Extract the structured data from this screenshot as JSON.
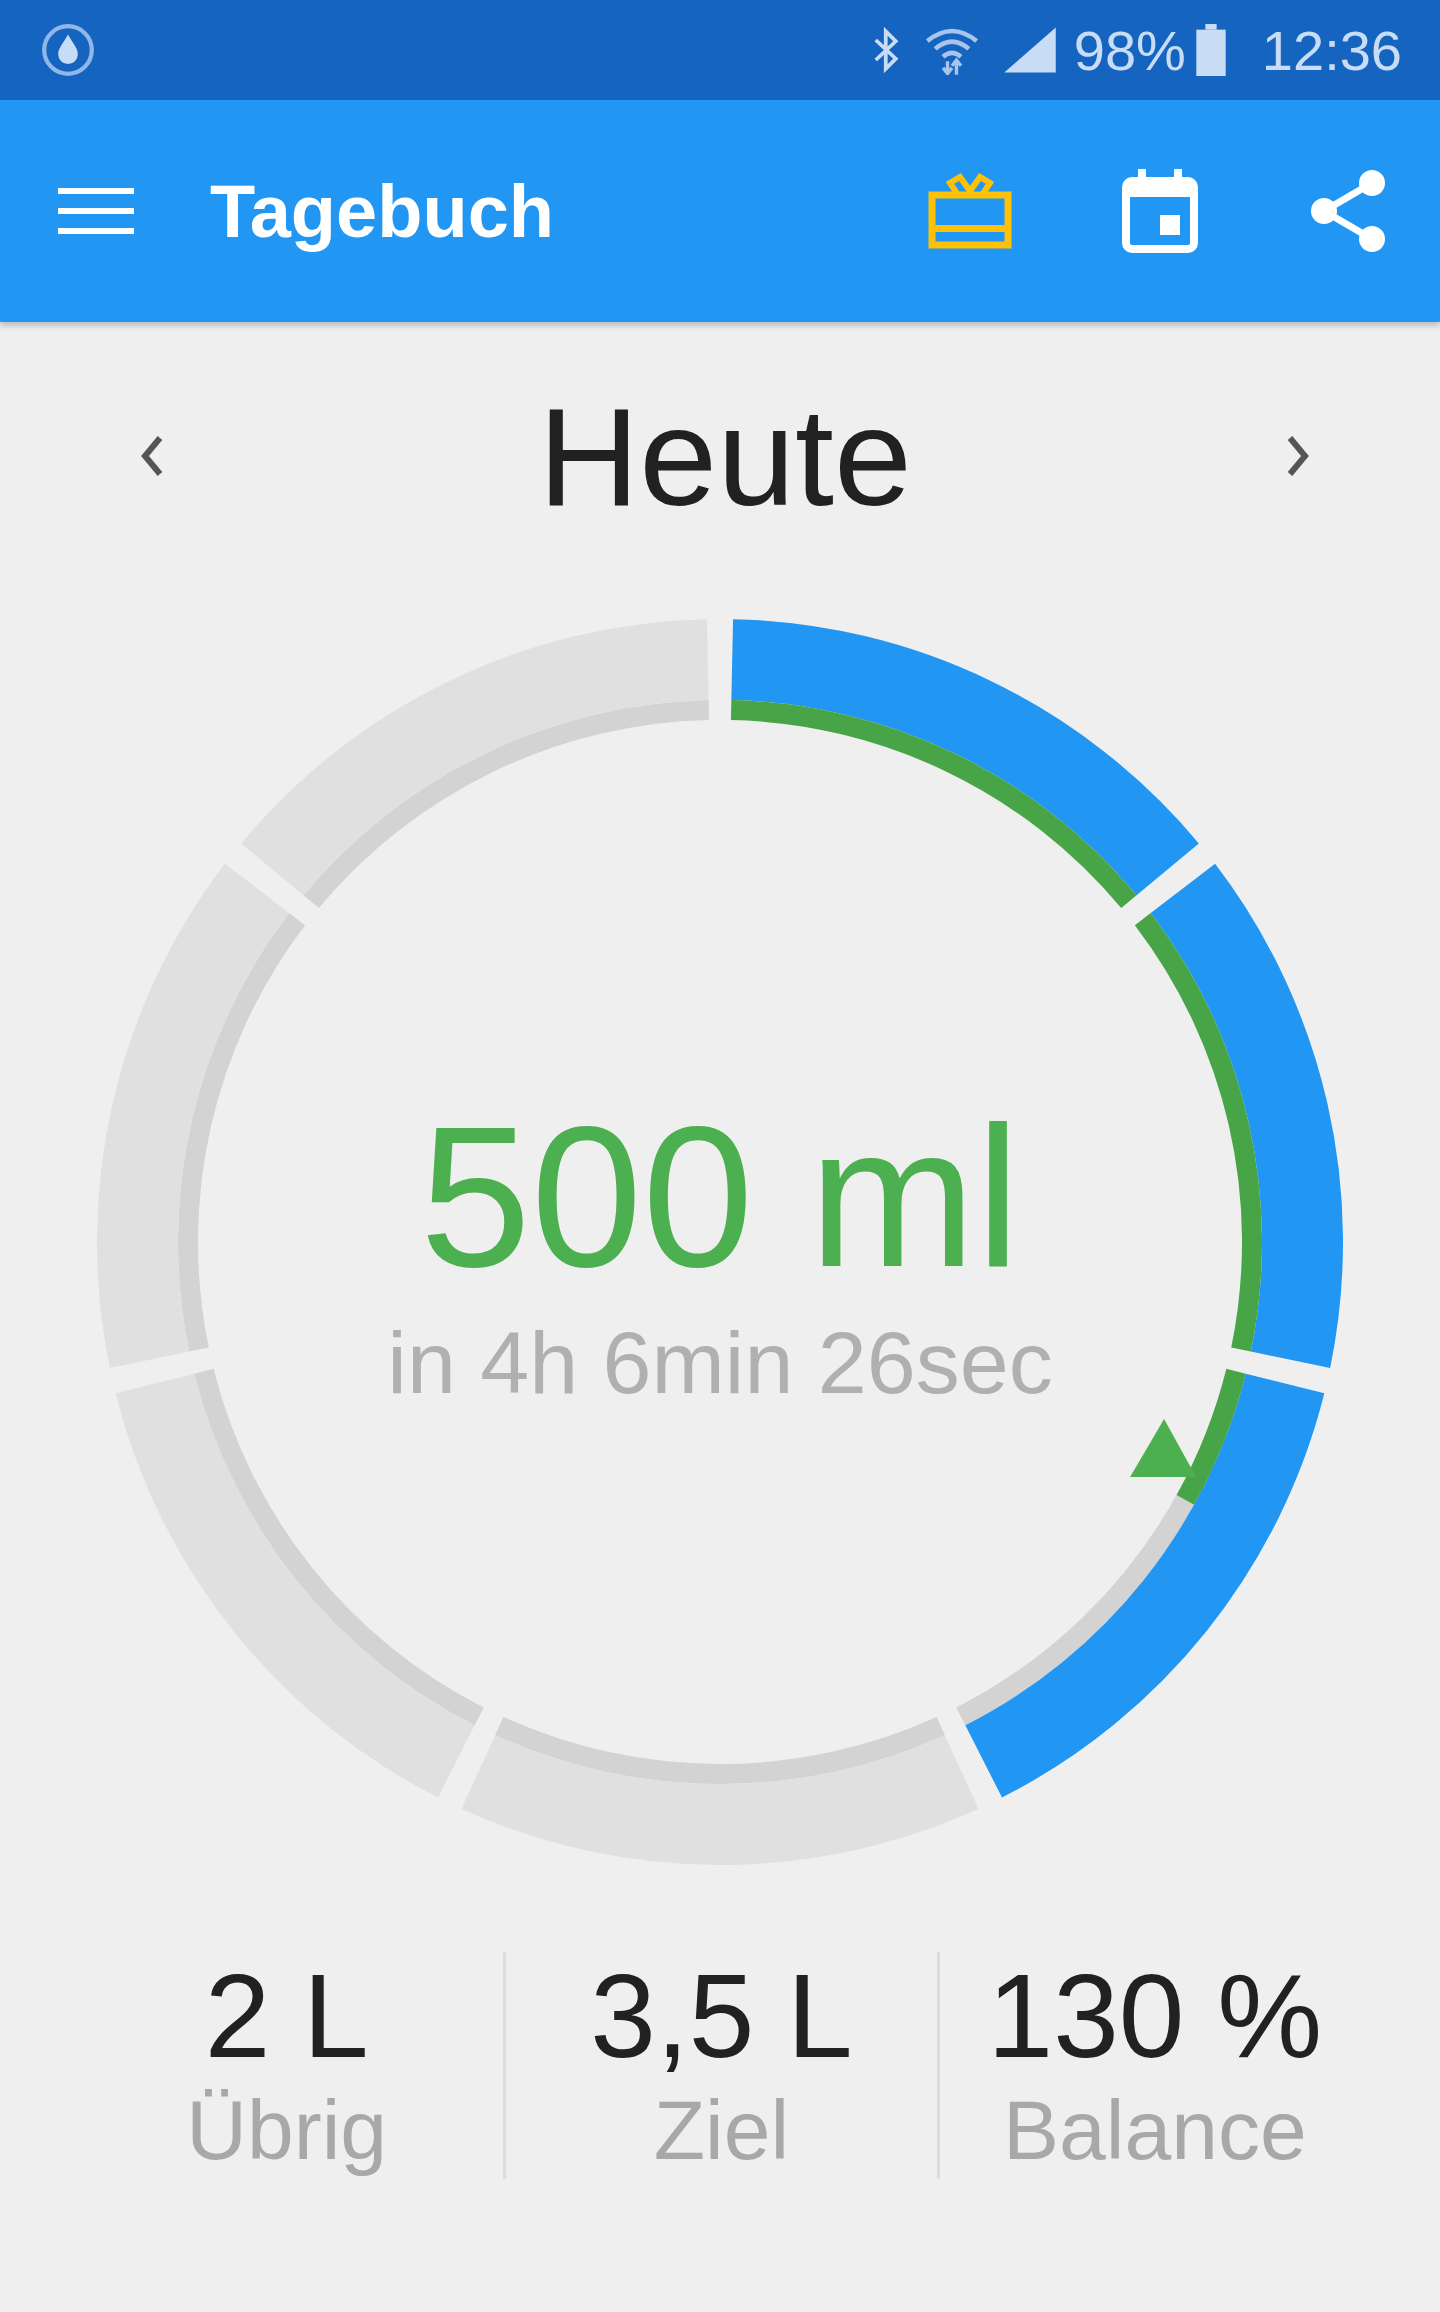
{
  "status_bar": {
    "battery": "98%",
    "time": "12:36"
  },
  "app_bar": {
    "title": "Tagebuch"
  },
  "day_nav": {
    "label": "Heute"
  },
  "ring": {
    "amount": "500 ml",
    "countdown": "in 4h 6min 26sec",
    "segments": [
      {
        "filled": true
      },
      {
        "filled": true
      },
      {
        "filled": true
      },
      {
        "filled": false
      },
      {
        "filled": false
      },
      {
        "filled": false
      },
      {
        "filled": false
      }
    ]
  },
  "stats": [
    {
      "value": "2 L",
      "label": "Übrig"
    },
    {
      "value": "3,5 L",
      "label": "Ziel"
    },
    {
      "value": "130 %",
      "label": "Balance"
    }
  ]
}
